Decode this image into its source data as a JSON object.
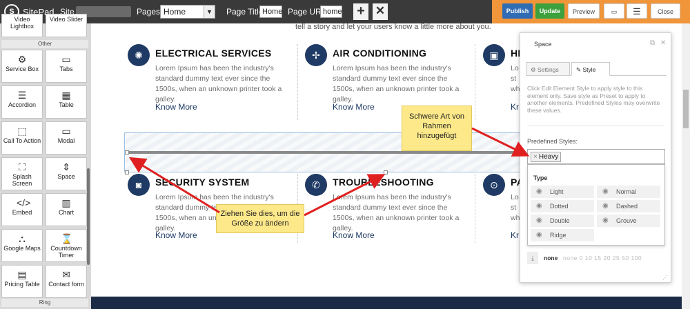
{
  "topbar": {
    "brand": "SitePad",
    "site_label": "Site :",
    "pages_label": "Pages :",
    "pages_value": "Home",
    "page_title_label": "Page Title:",
    "page_title_value": "Home",
    "page_url_label": "Page URL:",
    "page_url_value": "home",
    "add_icon": "plus-icon",
    "delete_icon": "x-icon",
    "publish_label": "Publish",
    "update_label": "Update",
    "preview_label": "Preview",
    "close_label": "Close",
    "accent_color": "#f0953a"
  },
  "sidebar": {
    "top_items": [
      {
        "label": "Video Lightbox"
      },
      {
        "label": "Video Slider"
      }
    ],
    "section_other": "Other",
    "items": [
      {
        "label": "Service Box",
        "icon": "gear-icon"
      },
      {
        "label": "Tabs",
        "icon": "tabs-icon"
      },
      {
        "label": "Accordion",
        "icon": "accordion-icon"
      },
      {
        "label": "Table",
        "icon": "table-icon"
      },
      {
        "label": "Call To Action",
        "icon": "cursor-icon"
      },
      {
        "label": "Modal",
        "icon": "modal-icon"
      },
      {
        "label": "Splash Screen",
        "icon": "splash-icon"
      },
      {
        "label": "Space",
        "icon": "space-icon"
      },
      {
        "label": "Embed",
        "icon": "code-icon"
      },
      {
        "label": "Chart",
        "icon": "chart-icon"
      },
      {
        "label": "Google Maps",
        "icon": "map-icon"
      },
      {
        "label": "Countdown Timer",
        "icon": "hourglass-icon"
      },
      {
        "label": "Pricing Table",
        "icon": "pricing-icon"
      },
      {
        "label": "Contact form",
        "icon": "contact-icon"
      }
    ],
    "section_bottom": "Ring"
  },
  "canvas": {
    "intro": "tell a story and let your users know a little more about you.",
    "services": [
      {
        "title": "ELECTRICAL SERVICES",
        "text": "Lorem Ipsum has been the industry's standard dummy text ever since the 1500s, when an unknown printer took a galley.",
        "link": "Know More",
        "icon": "lightbulb-icon"
      },
      {
        "title": "AIR CONDITIONING",
        "text": "Lorem Ipsum has been the industry's standard dummy text ever since the 1500s, when an unknown printer took a galley.",
        "link": "Know More",
        "icon": "fan-icon"
      },
      {
        "title": "HE",
        "text": "Lo st wh",
        "link": "Kr",
        "icon": "heater-icon"
      },
      {
        "title": "SECURITY SYSTEM",
        "text": "Lorem Ipsum has been the industry's standard dummy text ever since the 1500s, when an unknown printer took a galley.",
        "link": "Know More",
        "icon": "camera-icon"
      },
      {
        "title": "TROUBLESHOOTING",
        "text": "Lorem Ipsum has been the industry's standard dummy text ever since the 1500s, when an unknown printer took a galley.",
        "link": "Know More",
        "icon": "phone-gear-icon"
      },
      {
        "title": "PA",
        "text": "Lo st wh",
        "link": "Kr",
        "icon": "socket-icon"
      }
    ]
  },
  "callouts": {
    "heavy": "Schwere Art von Rahmen hinzugefügt",
    "resize": "Ziehen Sie dies, um die Größe zu ändern"
  },
  "panel": {
    "title": "Space",
    "tab_settings": "Settings",
    "tab_style": "Style",
    "help": "Click Edit Element Style to apply style to this element only. Save style as Preset to apply to another elements. Predefined Styles may overwrite these values.",
    "predefined_label": "Predefined Styles:",
    "chip": "Heavy",
    "type_label": "Type",
    "options": [
      "Light",
      "Normal",
      "Dotted",
      "Dashed",
      "Double",
      "Grouve",
      "Ridge"
    ],
    "size_selected": "none",
    "size_options": "none  0  10  15  20  25  50  100"
  }
}
